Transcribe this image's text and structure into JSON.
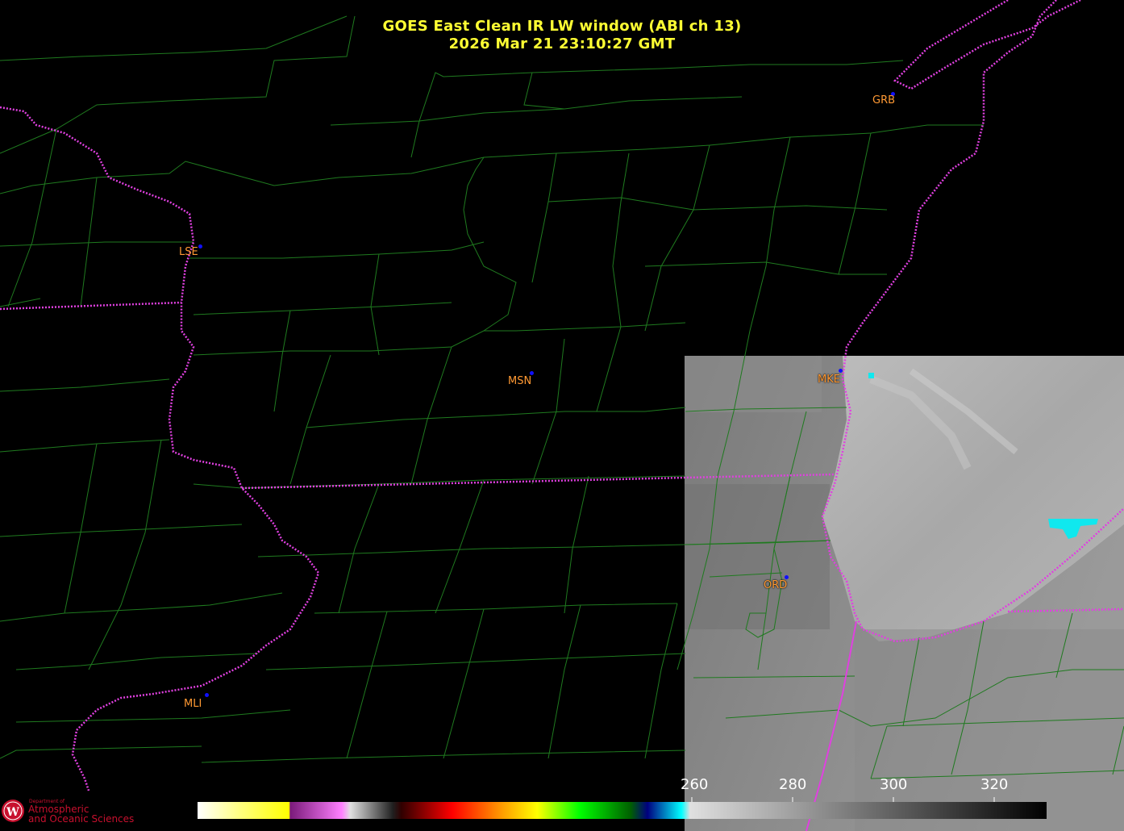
{
  "title": {
    "line1": "GOES East Clean IR LW window (ABI ch 13)",
    "line2": "2026 Mar 21  23:10:27 GMT"
  },
  "stations": [
    {
      "id": "GRB"
    },
    {
      "id": "LSE"
    },
    {
      "id": "MSN"
    },
    {
      "id": "MKE"
    },
    {
      "id": "ORD"
    },
    {
      "id": "MLI"
    }
  ],
  "colorbar": {
    "tick_labels": [
      "260",
      "280",
      "300",
      "320"
    ]
  },
  "logo": {
    "dept": "Department of",
    "line1": "Atmospheric",
    "line2": "and Oceanic Sciences"
  },
  "colors": {
    "title": "#ffff33",
    "county_lines": "#1f7a1f",
    "state_lines": "#e040e0",
    "station_label": "#ff9933",
    "station_dot": "#1010ff",
    "background": "#000000"
  }
}
